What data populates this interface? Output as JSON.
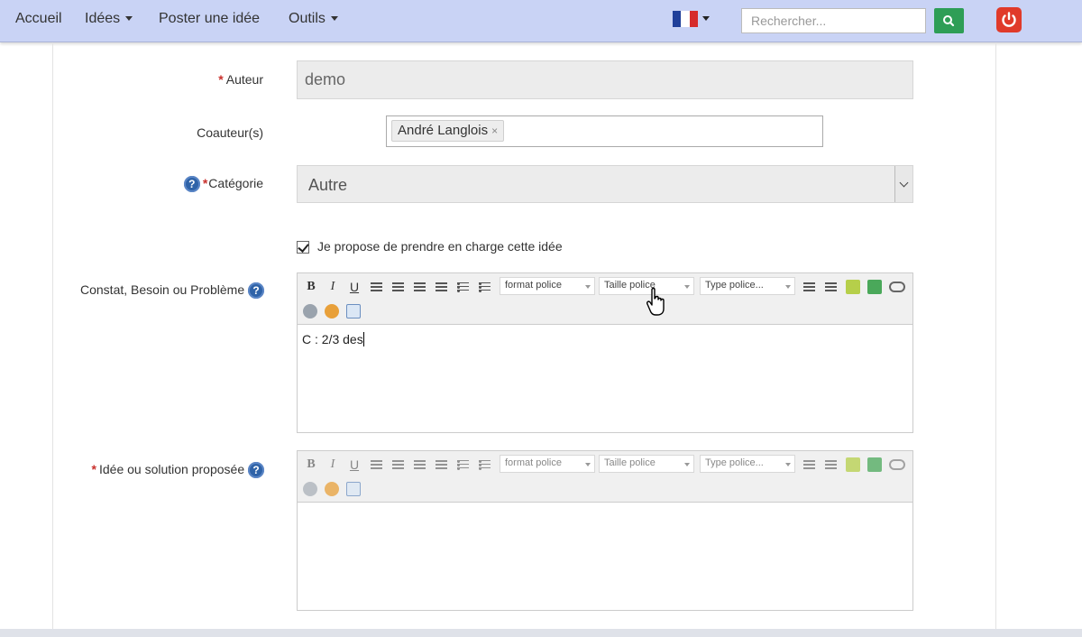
{
  "nav": {
    "home": "Accueil",
    "ideas": "Idées",
    "post_idea": "Poster une idée",
    "tools": "Outils",
    "language_flag": "france-flag-icon",
    "search_placeholder": "Rechercher...",
    "search_icon": "search-icon",
    "power_icon": "power-icon",
    "colors": {
      "navbar": "#c9d3f5",
      "search_button": "#2e9e56",
      "power_button": "#e03a2a"
    }
  },
  "form": {
    "author": {
      "required_mark": "*",
      "label": "Auteur",
      "value": "demo"
    },
    "coauthors": {
      "label": "Coauteur(s)",
      "tags": [
        "André Langlois"
      ],
      "remove_symbol": "×"
    },
    "category": {
      "help": "?",
      "required_mark": "*",
      "label": "Catégorie",
      "value": "Autre"
    },
    "take_charge": {
      "checked": true,
      "label": "Je propose de prendre en charge cette idée"
    },
    "constat": {
      "label": "Constat, Besoin ou Problème",
      "help": "?",
      "content": "C : 2/3 des"
    },
    "solution": {
      "required_mark": "*",
      "label": "Idée ou solution proposée",
      "help": "?",
      "content": ""
    }
  },
  "toolbar": {
    "bold": "B",
    "italic": "I",
    "underline": "U",
    "format_font": "format police",
    "font_size": "Taille police",
    "font_type": "Type police..."
  }
}
